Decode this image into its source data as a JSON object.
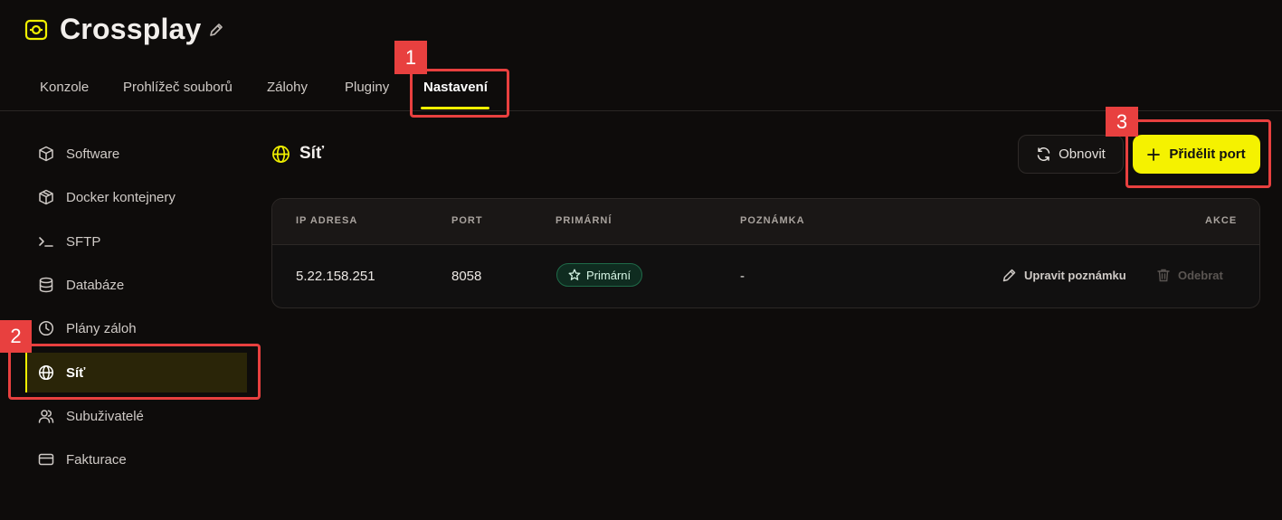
{
  "app": {
    "title": "Crossplay"
  },
  "tabs": [
    {
      "label": "Konzole"
    },
    {
      "label": "Prohlížeč souborů"
    },
    {
      "label": "Zálohy"
    },
    {
      "label": "Pluginy"
    },
    {
      "label": "Nastavení",
      "active": true
    }
  ],
  "sidebar": {
    "items": [
      {
        "label": "Software",
        "icon": "cube-icon"
      },
      {
        "label": "Docker kontejnery",
        "icon": "box-icon"
      },
      {
        "label": "SFTP",
        "icon": "terminal-icon"
      },
      {
        "label": "Databáze",
        "icon": "database-icon"
      },
      {
        "label": "Plány záloh",
        "icon": "clock-icon"
      },
      {
        "label": "Síť",
        "icon": "globe-icon",
        "active": true
      },
      {
        "label": "Subuživatelé",
        "icon": "users-icon"
      },
      {
        "label": "Fakturace",
        "icon": "credit-card-icon"
      }
    ]
  },
  "section": {
    "title": "Síť",
    "refresh_label": "Obnovit",
    "add_label": "Přidělit port"
  },
  "table": {
    "headers": [
      "IP ADRESA",
      "PORT",
      "PRIMÁRNÍ",
      "POZNÁMKA",
      "AKCE"
    ],
    "rows": [
      {
        "ip": "5.22.158.251",
        "port": "8058",
        "primary": "Primární",
        "note": "-",
        "edit_label": "Upravit poznámku",
        "remove_label": "Odebrat"
      }
    ]
  },
  "annotations": [
    "1",
    "2",
    "3"
  ],
  "colors": {
    "accent": "#f5f200",
    "background": "#0e0c0b",
    "annotation": "#e8403f",
    "badge_green": "#1f6a48"
  }
}
